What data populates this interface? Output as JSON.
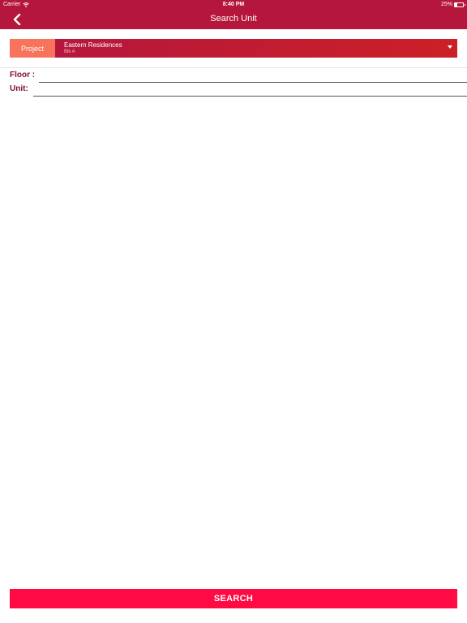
{
  "status_bar": {
    "carrier": "Carrier",
    "time": "8:40 PM",
    "battery_text": "25%",
    "battery_level": 0.25
  },
  "nav": {
    "title": "Search Unit",
    "back_icon": "chevron-left-icon"
  },
  "project": {
    "label": "Project",
    "selected_name": "Eastern Residences",
    "selected_block": "Blk A",
    "dropdown_icon": "caret-down-icon"
  },
  "form": {
    "floor_label": "Floor :",
    "floor_value": "",
    "unit_label": "Unit:",
    "unit_value": ""
  },
  "search_button": {
    "label": "SEARCH"
  },
  "colors": {
    "primary": "#b5173c",
    "project_label_bg": "#f7735b",
    "search_button": "#ff0a43",
    "field_label": "#7d0f2b"
  }
}
